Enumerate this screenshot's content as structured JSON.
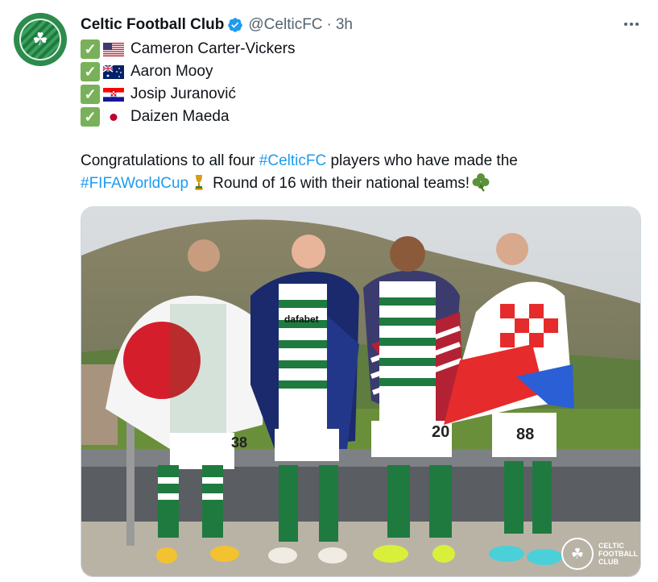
{
  "tweet": {
    "author": {
      "display_name": "Celtic Football Club",
      "handle": "@CelticFC",
      "verified": true,
      "avatar_icon": "celtic-crest-icon"
    },
    "separator": "·",
    "time": "3h",
    "players": [
      {
        "check": "✓",
        "flag": "usa-flag-icon",
        "name": "Cameron Carter-Vickers"
      },
      {
        "check": "✓",
        "flag": "australia-flag-icon",
        "name": "Aaron Mooy"
      },
      {
        "check": "✓",
        "flag": "croatia-flag-icon",
        "name": "Josip Juranović"
      },
      {
        "check": "✓",
        "flag": "japan-flag-icon",
        "name": "Daizen Maeda"
      }
    ],
    "text": {
      "part1": "Congratulations to all four ",
      "hashtag1": "#CelticFC",
      "part2": " players who have made the ",
      "hashtag2": "#FIFAWorldCup",
      "part3": "Round of 16 with their national teams!"
    },
    "media": {
      "kit_sponsor": "dafabet",
      "shirt_numbers": [
        "38",
        "20",
        "88"
      ],
      "watermark_lines": [
        "CELTIC",
        "FOOTBALL",
        "CLUB"
      ]
    }
  },
  "colors": {
    "link": "#1d9bf0",
    "secondary_text": "#536471",
    "check_green": "#78b159",
    "celtic_green": "#1f7a3f"
  }
}
